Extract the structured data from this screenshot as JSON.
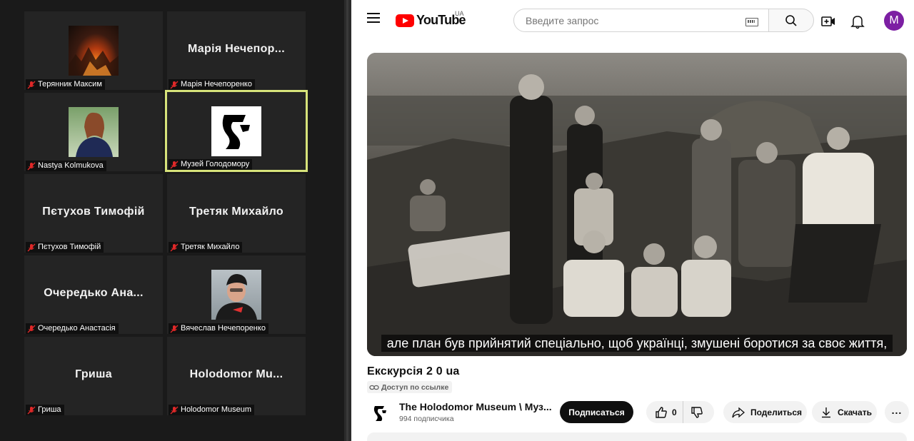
{
  "zoom": {
    "tiles": [
      {
        "name": "Терянник  Максим",
        "display": "",
        "has_photo": true
      },
      {
        "name": "Марія Нечепоренко",
        "display": "Марія  Нечепор..."
      },
      {
        "name": "Nastya Kolmukova",
        "display": "",
        "has_photo": true
      },
      {
        "name": "Музей Голодомору",
        "display": "",
        "has_logo": true
      },
      {
        "name": "Пєтухов Тимофій",
        "display": "Пєтухов Тимофій"
      },
      {
        "name": "Третяк Михайло",
        "display": "Третяк Михайло"
      },
      {
        "name": "Очередько Анастасія",
        "display": "Очередько  Ана..."
      },
      {
        "name": "Вячеслав Нечепоренко",
        "display": "",
        "has_photo": true
      },
      {
        "name": "Гриша",
        "display": "Гриша"
      },
      {
        "name": "Holodomor Museum",
        "display": "Holodomor  Mu..."
      }
    ]
  },
  "youtube": {
    "logo_text": "YouTube",
    "region": "UA",
    "search_placeholder": "Введите запрос",
    "avatar_letter": "M",
    "caption": "але план був прийнятий спеціально, щоб українці, змушені боротися за своє життя,",
    "video_title": "Екскурсія 2 0 ua",
    "access_label": "Доступ по ссылке",
    "channel_name": "The Holodomor Museum \\ Муз...",
    "subscribers": "994 подписчика",
    "subscribe_label": "Подписаться",
    "like_count": "0",
    "share_label": "Поделиться",
    "download_label": "Скачать",
    "more_label": "..."
  },
  "colors": {
    "active_speaker": "#d7e37a",
    "yt_red": "#ff0000",
    "avatar": "#7c1fa3"
  }
}
